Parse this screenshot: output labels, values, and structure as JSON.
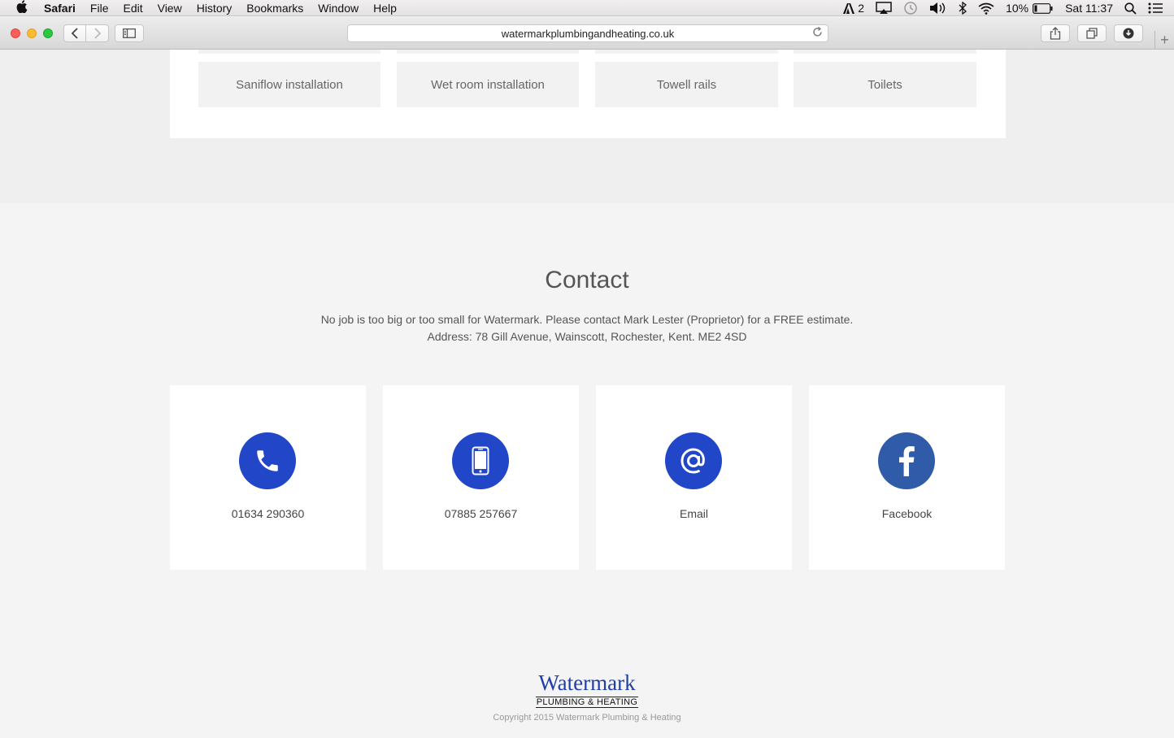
{
  "menubar": {
    "app": "Safari",
    "items": [
      "File",
      "Edit",
      "View",
      "History",
      "Bookmarks",
      "Window",
      "Help"
    ],
    "status": {
      "adobe_count": "2",
      "battery": "10%",
      "clock": "Sat 11:37"
    }
  },
  "browser": {
    "url": "watermarkplumbingandheating.co.uk"
  },
  "services": {
    "tiles": [
      "Saniflow installation",
      "Wet room installation",
      "Towell rails",
      "Toilets"
    ]
  },
  "contact": {
    "title": "Contact",
    "line1": "No job is too big or too small for Watermark. Please contact Mark Lester (Proprietor) for a FREE estimate.",
    "line2": "Address: 78 Gill Avenue, Wainscott, Rochester, Kent. ME2 4SD",
    "cards": [
      {
        "icon": "phone-icon",
        "label": "01634 290360"
      },
      {
        "icon": "mobile-phone-icon",
        "label": "07885 257667"
      },
      {
        "icon": "at-sign-icon",
        "label": "Email"
      },
      {
        "icon": "facebook-icon",
        "label": "Facebook"
      }
    ]
  },
  "footer": {
    "logo_word": "Watermark",
    "logo_sub": "PLUMBING & HEATING",
    "copyright": "Copyright 2015 Watermark Plumbing & Heating"
  },
  "colors": {
    "accent_blue": "#2146c7",
    "facebook_blue": "#2f5ba9",
    "logo_blue": "#1f3ea8"
  }
}
